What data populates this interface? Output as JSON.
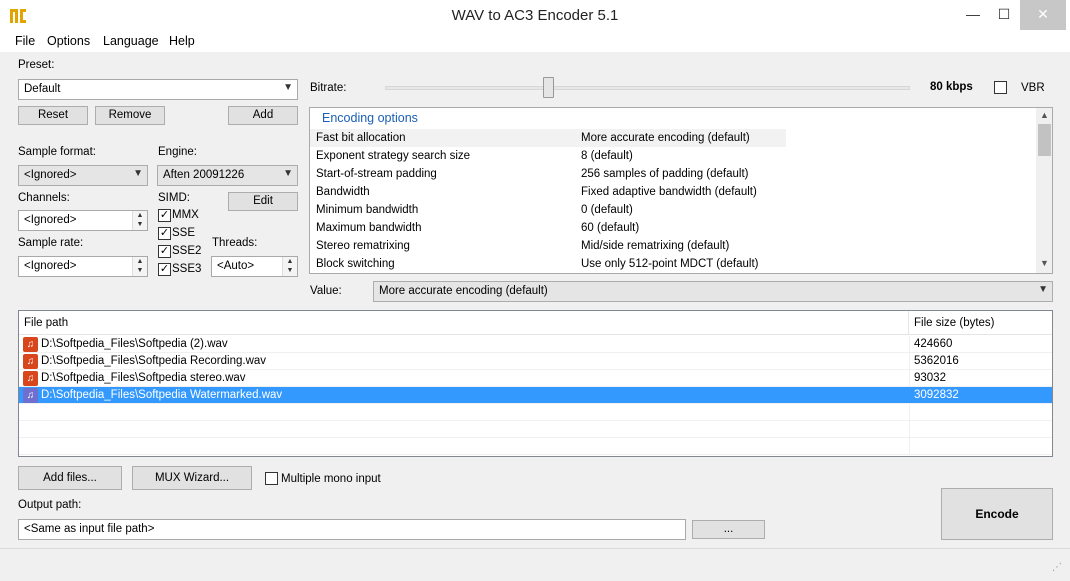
{
  "window": {
    "title": "WAV to AC3 Encoder 5.1",
    "min_glyph": "—",
    "max_glyph": "☐",
    "close_glyph": "✕"
  },
  "menu": [
    "File",
    "Options",
    "Language",
    "Help"
  ],
  "preset": {
    "label": "Preset:",
    "value": "Default",
    "reset": "Reset",
    "remove": "Remove",
    "add": "Add"
  },
  "bitrate": {
    "label": "Bitrate:",
    "value": "80 kbps",
    "level": 0.31,
    "vbr_label": "VBR",
    "vbr_checked": false
  },
  "sample_format": {
    "label": "Sample format:",
    "value": "<Ignored>"
  },
  "engine": {
    "label": "Engine:",
    "value": "Aften 20091226",
    "edit": "Edit"
  },
  "channels": {
    "label": "Channels:",
    "value": "<Ignored>"
  },
  "simd": {
    "label": "SIMD:",
    "items": [
      {
        "label": "MMX",
        "checked": true
      },
      {
        "label": "SSE",
        "checked": true
      },
      {
        "label": "SSE2",
        "checked": true
      },
      {
        "label": "SSE3",
        "checked": true
      }
    ]
  },
  "sample_rate": {
    "label": "Sample rate:",
    "value": "<Ignored>"
  },
  "threads": {
    "label": "Threads:",
    "value": "<Auto>"
  },
  "encoding_options": {
    "group": "Encoding options",
    "rows": [
      {
        "name": "Fast bit allocation",
        "value": "More accurate encoding (default)"
      },
      {
        "name": "Exponent strategy search size",
        "value": "8 (default)"
      },
      {
        "name": "Start-of-stream padding",
        "value": "256 samples of padding (default)"
      },
      {
        "name": "Bandwidth",
        "value": "Fixed adaptive bandwidth (default)"
      },
      {
        "name": "Minimum bandwidth",
        "value": "0 (default)"
      },
      {
        "name": "Maximum bandwidth",
        "value": "60 (default)"
      },
      {
        "name": "Stereo rematrixing",
        "value": "Mid/side rematrixing (default)"
      },
      {
        "name": "Block switching",
        "value": "Use only 512-point MDCT (default)"
      }
    ]
  },
  "value_row": {
    "label": "Value:",
    "value": "More accurate encoding (default)"
  },
  "files": {
    "col_path": "File path",
    "col_size": "File size (bytes)",
    "rows": [
      {
        "path": "D:\\Softpedia_Files\\Softpedia (2).wav",
        "size": "424660"
      },
      {
        "path": "D:\\Softpedia_Files\\Softpedia Recording.wav",
        "size": "5362016"
      },
      {
        "path": "D:\\Softpedia_Files\\Softpedia stereo.wav",
        "size": "93032"
      },
      {
        "path": "D:\\Softpedia_Files\\Softpedia Watermarked.wav",
        "size": "3092832"
      }
    ]
  },
  "actions": {
    "add_files": "Add files...",
    "mux_wizard": "MUX Wizard...",
    "multiple_mono": "Multiple mono input",
    "output_label": "Output path:",
    "output_value": "<Same as input file path>",
    "browse": "...",
    "encode": "Encode"
  },
  "colors": {
    "accent": "#3399ff",
    "group_title": "#1b5fb5",
    "file_icon": "#d8461e"
  }
}
